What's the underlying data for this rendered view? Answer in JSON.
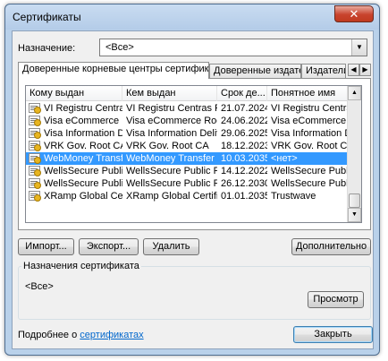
{
  "window": {
    "title": "Сертификаты",
    "close_label": "✕"
  },
  "purpose": {
    "label": "Назначение:",
    "value": "<Все>"
  },
  "tabs": [
    {
      "label": "Доверенные корневые центры сертификации",
      "active": true
    },
    {
      "label": "Доверенные издатели",
      "active": false
    },
    {
      "label": "Издатели, не",
      "active": false
    }
  ],
  "tab_scroll": {
    "left": "◀",
    "right": "▶"
  },
  "columns": [
    "Кому выдан",
    "Кем выдан",
    "Срок де...",
    "Понятное имя"
  ],
  "rows": [
    {
      "issued_to": "VI Registru Centras R...",
      "issued_by": "VI Registru Centras R...",
      "expires": "21.07.2024",
      "name": "VI Registru Centras...",
      "selected": false
    },
    {
      "issued_to": "Visa eCommerce Root",
      "issued_by": "Visa eCommerce Root",
      "expires": "24.06.2022",
      "name": "Visa eCommerce Root",
      "selected": false
    },
    {
      "issued_to": "Visa Information Deli...",
      "issued_by": "Visa Information Deliv...",
      "expires": "29.06.2025",
      "name": "Visa Information Del...",
      "selected": false
    },
    {
      "issued_to": "VRK Gov. Root CA",
      "issued_by": "VRK Gov. Root CA",
      "expires": "18.12.2023",
      "name": "VRK Gov. Root CA",
      "selected": false
    },
    {
      "issued_to": "WebMoney Transfe...",
      "issued_by": "WebMoney Transfer ...",
      "expires": "10.03.2035",
      "name": "<нет>",
      "selected": true
    },
    {
      "issued_to": "WellsSecure Public ...",
      "issued_by": "WellsSecure Public R...",
      "expires": "14.12.2022",
      "name": "WellsSecure Public ...",
      "selected": false
    },
    {
      "issued_to": "WellsSecure Public ...",
      "issued_by": "WellsSecure Public R...",
      "expires": "26.12.2030",
      "name": "WellsSecure Public ...",
      "selected": false
    },
    {
      "issued_to": "XRamp Global Certi...",
      "issued_by": "XRamp Global Certific...",
      "expires": "01.01.2035",
      "name": "Trustwave",
      "selected": false
    }
  ],
  "scrollbar": {
    "up": "▲",
    "down": "▼"
  },
  "buttons": {
    "import": "Импорт...",
    "export": "Экспорт...",
    "remove": "Удалить",
    "advanced": "Дополнительно",
    "view": "Просмотр",
    "close": "Закрыть"
  },
  "purposes_group": {
    "title": "Назначения сертификата",
    "value": "<Все>"
  },
  "footer": {
    "text": "Подробнее о ",
    "link": "сертификатах"
  },
  "icons": {
    "row_icon": "certificate-icon",
    "combo_arrow": "chevron-down-icon"
  }
}
